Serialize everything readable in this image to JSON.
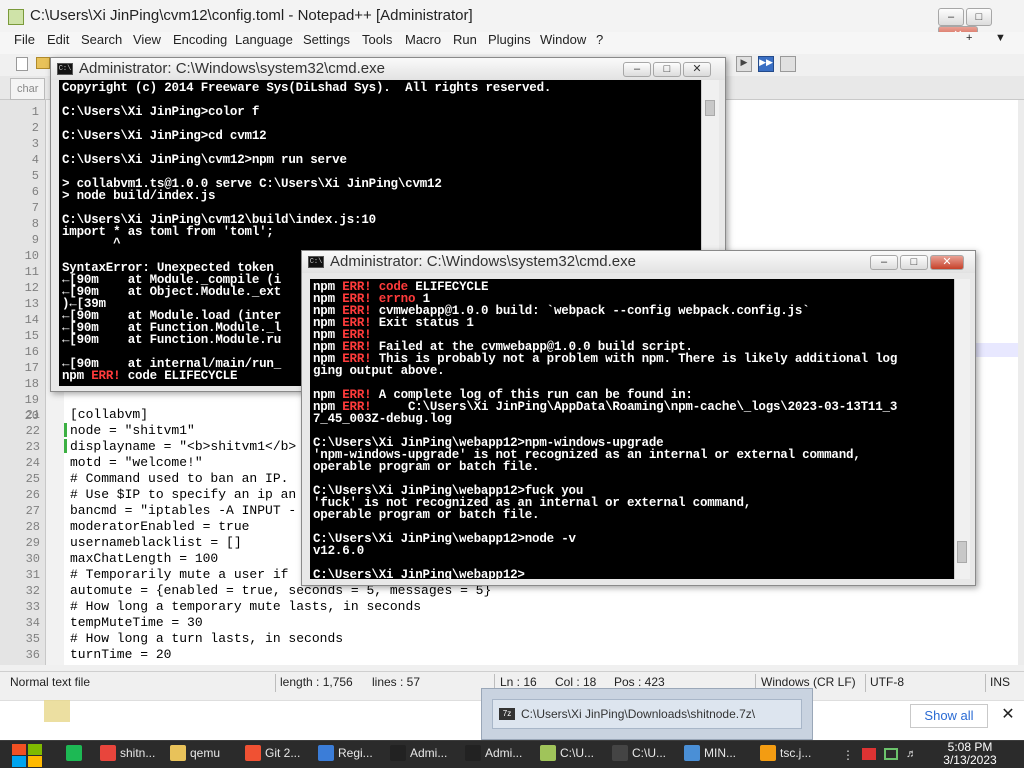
{
  "notepad": {
    "title": "C:\\Users\\Xi JinPing\\cvm12\\config.toml - Notepad++ [Administrator]",
    "menu": [
      "File",
      "Edit",
      "Search",
      "View",
      "Encoding",
      "Language",
      "Settings",
      "Tools",
      "Macro",
      "Run",
      "Plugins",
      "Window",
      "?"
    ],
    "tab_partial": "char",
    "line_numbers": [
      "1",
      "2",
      "3",
      "4",
      "5",
      "6",
      "7",
      "8",
      "9",
      "10",
      "11",
      "12",
      "13",
      "14",
      "15",
      "16",
      "17",
      "18",
      "19",
      "20",
      "21",
      "22",
      "23",
      "24",
      "25",
      "26",
      "27",
      "28",
      "29",
      "30",
      "31",
      "32",
      "33",
      "34",
      "35"
    ],
    "code_lines": [
      {
        "n": "21",
        "text": "[collabvm]"
      },
      {
        "n": "22",
        "text": "node = \"shitvm1\""
      },
      {
        "n": "23",
        "text": "displayname = \"<b>shitvm1</b>"
      },
      {
        "n": "24",
        "text": "motd = \"welcome!\""
      },
      {
        "n": "25",
        "text": "# Command used to ban an IP."
      },
      {
        "n": "26",
        "text": "# Use $IP to specify an ip an"
      },
      {
        "n": "27",
        "text": "bancmd = \"iptables -A INPUT -"
      },
      {
        "n": "28",
        "text": "moderatorEnabled = true"
      },
      {
        "n": "29",
        "text": "usernameblacklist = []"
      },
      {
        "n": "30",
        "text": "maxChatLength = 100"
      },
      {
        "n": "31",
        "text": "# Temporarily mute a user if"
      },
      {
        "n": "32",
        "text": "automute = {enabled = true, seconds = 5, messages = 5}"
      },
      {
        "n": "33",
        "text": "# How long a temporary mute lasts, in seconds"
      },
      {
        "n": "34",
        "text": "tempMuteTime = 30"
      },
      {
        "n": "35",
        "text": "# How long a turn lasts, in seconds"
      },
      {
        "n": "36",
        "text": "turnTime = 20"
      }
    ],
    "status": {
      "type": "Normal text file",
      "length": "length : 1,756",
      "lines": "lines : 57",
      "ln": "Ln : 16",
      "col": "Col : 18",
      "pos": "Pos : 423",
      "eol": "Windows (CR LF)",
      "encoding": "UTF-8",
      "mode": "INS"
    }
  },
  "cmd1": {
    "title": "Administrator: C:\\Windows\\system32\\cmd.exe",
    "lines": [
      "Copyright (c) 2014 Freeware Sys(DiLshad Sys).  All rights reserved.",
      "",
      "C:\\Users\\Xi JinPing>color f",
      "",
      "C:\\Users\\Xi JinPing>cd cvm12",
      "",
      "C:\\Users\\Xi JinPing\\cvm12>npm run serve",
      "",
      "> collabvm1.ts@1.0.0 serve C:\\Users\\Xi JinPing\\cvm12",
      "> node build/index.js",
      "",
      "C:\\Users\\Xi JinPing\\cvm12\\build\\index.js:10",
      "import * as toml from 'toml';",
      "       ^",
      "",
      "SyntaxError: Unexpected token",
      "←[90m    at Module._compile (i",
      "←[90m    at Object.Module._ext",
      ")←[39m",
      "←[90m    at Module.load (inter",
      "←[90m    at Function.Module._l",
      "←[90m    at Function.Module.ru",
      "",
      "←[90m    at internal/main/run_"
    ],
    "last_prefix": "npm ",
    "last_err": "ERR!",
    "last_rest": " code ELIFECYCLE"
  },
  "cmd2": {
    "title": "Administrator: C:\\Windows\\system32\\cmd.exe",
    "npm_lines": [
      {
        "err": true,
        "rest": " code ELIFECYCLE",
        "hl": "code"
      },
      {
        "err": true,
        "rest": " errno 1",
        "hl": "errno"
      },
      {
        "err": true,
        "rest": " cvmwebapp@1.0.0 build: `webpack --config webpack.config.js`",
        "hl": ""
      },
      {
        "err": true,
        "rest": " Exit status 1",
        "hl": ""
      },
      {
        "err": true,
        "rest": "",
        "hl": ""
      },
      {
        "err": true,
        "rest": " Failed at the cvmwebapp@1.0.0 build script.",
        "hl": ""
      },
      {
        "err": true,
        "rest": " This is probably not a problem with npm. There is likely additional log",
        "hl": ""
      }
    ],
    "tail_lines": [
      "ging output above.",
      "",
      "npm ERR! A complete log of this run can be found in:",
      "npm ERR!     C:\\Users\\Xi JinPing\\AppData\\Roaming\\npm-cache\\_logs\\2023-03-13T11_3",
      "7_45_003Z-debug.log",
      "",
      "C:\\Users\\Xi JinPing\\webapp12>npm-windows-upgrade",
      "'npm-windows-upgrade' is not recognized as an internal or external command,",
      "operable program or batch file.",
      "",
      "C:\\Users\\Xi JinPing\\webapp12>fuck you",
      "'fuck' is not recognized as an internal or external command,",
      "operable program or batch file.",
      "",
      "C:\\Users\\Xi JinPing\\webapp12>node -v",
      "v12.6.0",
      "",
      "C:\\Users\\Xi JinPing\\webapp12>_"
    ]
  },
  "download": {
    "file": "C:\\Users\\Xi JinPing\\Downloads\\shitnode.7z\\",
    "show_all": "Show all",
    "zip_label": "7z"
  },
  "taskbar": {
    "items": [
      {
        "label": "",
        "color": "#1db954"
      },
      {
        "label": "shitn...",
        "color": "#e8453c"
      },
      {
        "label": "qemu",
        "color": "#e8c25a"
      },
      {
        "label": "Git 2...",
        "color": "#f05133"
      },
      {
        "label": "Regi...",
        "color": "#3b7dd8"
      },
      {
        "label": "Admi...",
        "color": "#222222"
      },
      {
        "label": "Admi...",
        "color": "#222222"
      },
      {
        "label": "C:\\U...",
        "color": "#a0c45a"
      },
      {
        "label": "C:\\U...",
        "color": "#444444"
      },
      {
        "label": "MIN...",
        "color": "#4a8fd6"
      },
      {
        "label": "tsc.j...",
        "color": "#f39c12"
      }
    ],
    "time": "5:08 PM",
    "date": "3/13/2023"
  }
}
